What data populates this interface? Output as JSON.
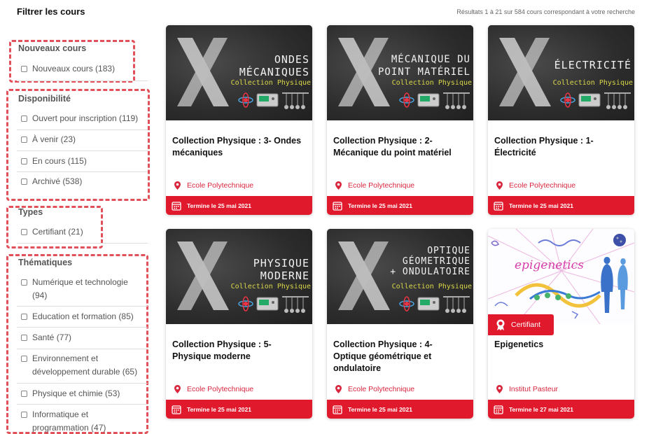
{
  "header": {
    "filter_title": "Filtrer les cours",
    "results": "Résultats 1 à 21 sur 584 cours correspondant à votre recherche"
  },
  "filters": {
    "new": {
      "title": "Nouveaux cours",
      "options": [
        "Nouveaux cours (183)"
      ]
    },
    "availability": {
      "title": "Disponibilité",
      "options": [
        "Ouvert pour inscription (119)",
        "À venir (23)",
        "En cours (115)",
        "Archivé (538)"
      ]
    },
    "types": {
      "title": "Types",
      "options": [
        "Certifiant (21)"
      ]
    },
    "themes": {
      "title": "Thématiques",
      "options": [
        "Numérique et technologie (94)",
        "Education et formation (85)",
        "Santé (77)",
        "Environnement et développement durable (65)",
        "Physique et chimie (53)",
        "Informatique et programmation (47)"
      ]
    }
  },
  "courses": [
    {
      "thumb_line1": "ONDES",
      "thumb_line2": "MÉCANIQUES",
      "thumb_sub": "Collection Physique",
      "title": "Collection Physique : 3- Ondes mécaniques",
      "org": "Ecole Polytechnique",
      "date": "Termine le 25 mai 2021"
    },
    {
      "thumb_line1": "MÉCANIQUE DU",
      "thumb_line2": "POINT MATÉRIEL",
      "thumb_sub": "Collection Physique",
      "title": "Collection Physique : 2- Mécanique du point matériel",
      "org": "Ecole Polytechnique",
      "date": "Termine le 25 mai 2021"
    },
    {
      "thumb_line1": "ÉLECTRICITÉ",
      "thumb_line2": "",
      "thumb_sub": "Collection Physique",
      "title": "Collection Physique : 1- Électricité",
      "org": "Ecole Polytechnique",
      "date": "Termine le 25 mai 2021"
    },
    {
      "thumb_line1": "PHYSIQUE",
      "thumb_line2": "MODERNE",
      "thumb_sub": "Collection Physique",
      "title": "Collection Physique : 5- Physique moderne",
      "org": "Ecole Polytechnique",
      "date": "Termine le 25 mai 2021"
    },
    {
      "thumb_line1": "OPTIQUE",
      "thumb_line2": "GÉOMETRIQUE",
      "thumb_line3": "+ ONDULATOIRE",
      "thumb_sub": "Collection Physique",
      "title": "Collection Physique : 4- Optique géométrique et ondulatoire",
      "org": "Ecole Polytechnique",
      "date": "Termine le 25 mai 2021"
    },
    {
      "thumb_word": "epigenetics",
      "badge": "Certifiant",
      "title": "Epigenetics",
      "org": "Institut Pasteur",
      "date": "Termine le 27 mai 2021"
    }
  ],
  "colors": {
    "accent": "#e1192c",
    "dashed_highlight": "#e2505a",
    "org_text": "#d9263d"
  }
}
